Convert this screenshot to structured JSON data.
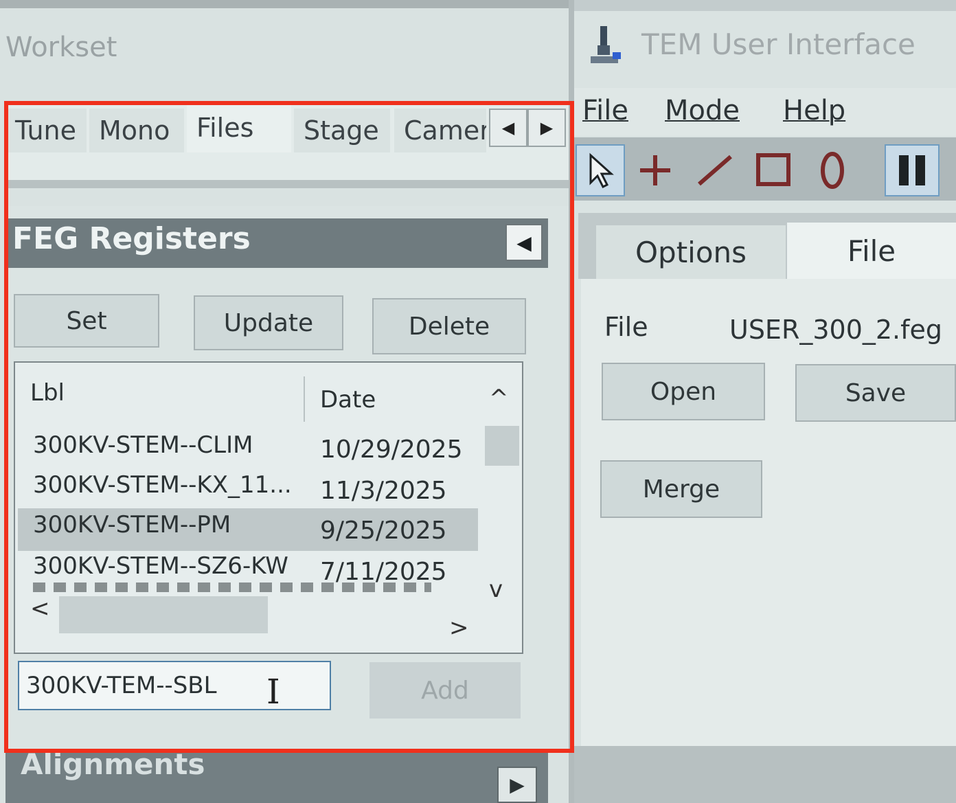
{
  "workset": {
    "title": "Workset",
    "tabs": [
      "Tune",
      "Mono",
      "Files",
      "Stage",
      "Camer"
    ],
    "active_tab": "Files",
    "scroll_left_glyph": "◀",
    "scroll_right_glyph": "▶"
  },
  "feg_registers": {
    "title": "FEG Registers",
    "collapse_glyph": "◀",
    "buttons": {
      "set": "Set",
      "update": "Update",
      "delete": "Delete"
    },
    "columns": {
      "label": "Lbl",
      "date": "Date"
    },
    "rows": [
      {
        "label": "300KV-STEM--CLIM",
        "date": "10/29/2025",
        "selected": false
      },
      {
        "label": "300KV-STEM--KX_11...",
        "date": "11/3/2025",
        "selected": false
      },
      {
        "label": "300KV-STEM--PM",
        "date": "9/25/2025",
        "selected": true
      },
      {
        "label": "300KV-STEM--SZ6-KW",
        "date": "7/11/2025",
        "selected": false
      }
    ],
    "scroll_glyphs": {
      "up": "^",
      "down": "v",
      "left": "<",
      "right": ">"
    },
    "new_label_input": {
      "value": "300KV-TEM--SBL"
    },
    "add_label": "Add"
  },
  "alignments": {
    "title": "Alignments",
    "expand_glyph": "▶"
  },
  "tem_ui": {
    "title": "TEM User Interface",
    "icon": "microscope-icon",
    "menu": [
      "File",
      "Mode",
      "Help"
    ],
    "toolbar_icons": [
      "pointer-icon",
      "crosshair-icon",
      "line-icon",
      "rectangle-icon",
      "ellipse-icon",
      "pause-icon"
    ],
    "tabs": [
      "Options",
      "File"
    ],
    "active_tab": "File",
    "file_label": "File",
    "file_name": "USER_300_2.feg",
    "buttons": {
      "open": "Open",
      "save": "Save",
      "merge": "Merge"
    }
  },
  "colors": {
    "highlight": "#f0301c",
    "header_bg": "#6f7b7f",
    "selection": "#bfc8c9",
    "input_border": "#4f7fa6"
  }
}
